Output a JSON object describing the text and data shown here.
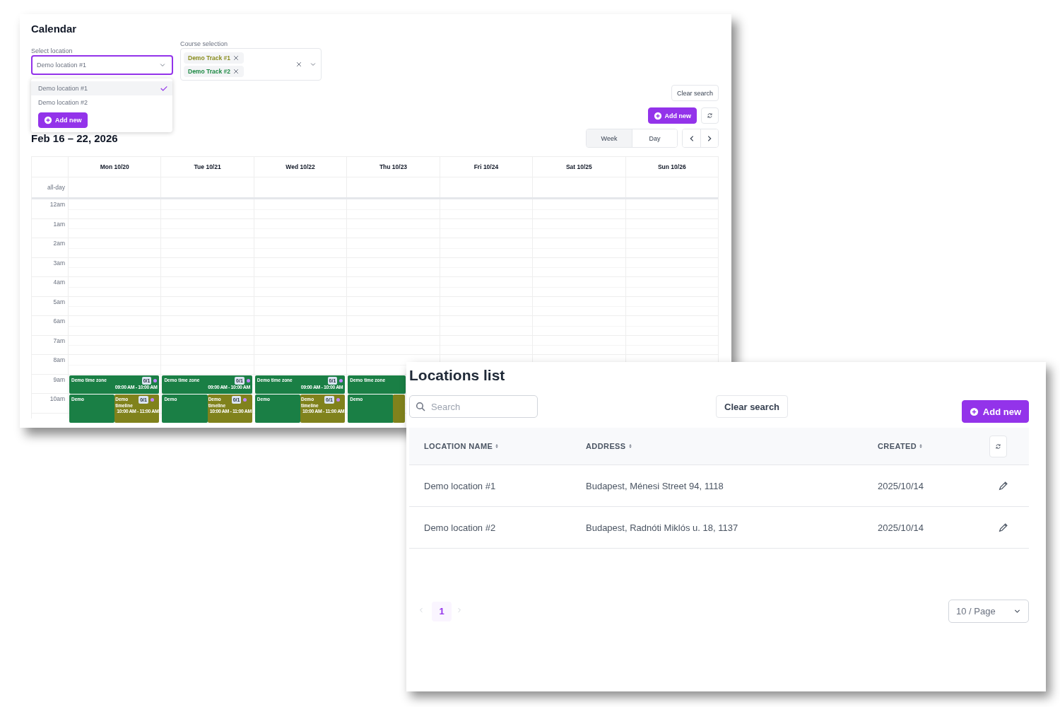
{
  "calendar": {
    "title": "Calendar",
    "location_select": {
      "label": "Select location",
      "value": "Demo location #1",
      "options": [
        {
          "label": "Demo location #1",
          "selected": true
        },
        {
          "label": "Demo location #2",
          "selected": false
        }
      ],
      "add_button": "Add new"
    },
    "course_select": {
      "label": "Course selection",
      "tags": [
        {
          "label": "Demo Track #1",
          "color": "#8a8d1f"
        },
        {
          "label": "Demo Track #2",
          "color": "#1e8a44"
        }
      ]
    },
    "clear_search": "Clear search",
    "add_new": "Add new",
    "date_range": "Feb 16 – 22, 2026",
    "view_tabs": [
      {
        "label": "Week",
        "selected": true
      },
      {
        "label": "Day",
        "selected": false
      }
    ],
    "all_day_label": "all-day",
    "hours": [
      "12am",
      "1am",
      "2am",
      "3am",
      "4am",
      "5am",
      "6am",
      "7am",
      "8am",
      "9am",
      "10am"
    ],
    "days": [
      {
        "label": "Mon 10/20",
        "events": [
          {
            "kind": "zone",
            "title": "Demo time zone",
            "badge": "0/1",
            "time": "09:00 AM - 10:00 AM"
          },
          {
            "kind": "demo",
            "title": "Demo"
          },
          {
            "kind": "timeline",
            "title": "Demo timeline",
            "badge": "0/1",
            "time": "10:00 AM - 11:00 AM"
          }
        ]
      },
      {
        "label": "Tue 10/21",
        "events": [
          {
            "kind": "zone",
            "title": "Demo time zone",
            "badge": "0/1",
            "time": "09:00 AM - 10:00 AM"
          },
          {
            "kind": "demo",
            "title": "Demo"
          },
          {
            "kind": "timeline",
            "title": "Demo timeline",
            "badge": "0/1",
            "time": "10:00 AM - 11:00 AM"
          }
        ]
      },
      {
        "label": "Wed 10/22",
        "events": [
          {
            "kind": "zone",
            "title": "Demo time zone",
            "badge": "0/1",
            "time": "09:00 AM - 10:00 AM"
          },
          {
            "kind": "demo",
            "title": "Demo"
          },
          {
            "kind": "timeline",
            "title": "Demo timeline",
            "badge": "0/1",
            "time": "10:00 AM - 11:00 AM"
          }
        ]
      },
      {
        "label": "Thu 10/23",
        "events": [
          {
            "kind": "zone",
            "title": "Demo time zone"
          },
          {
            "kind": "demo",
            "title": "Demo"
          },
          {
            "kind": "timeline"
          }
        ]
      },
      {
        "label": "Fri 10/24"
      },
      {
        "label": "Sat 10/25"
      },
      {
        "label": "Sun 10/26"
      }
    ]
  },
  "locations": {
    "title": "Locations list",
    "search": {
      "placeholder": "Search"
    },
    "clear_search": "Clear search",
    "add_new": "Add new",
    "columns": [
      "LOCATION NAME",
      "ADDRESS",
      "CREATED"
    ],
    "rows": [
      {
        "name": "Demo location #1",
        "address": "Budapest, Ménesi Street 94, 1118",
        "created": "2025/10/14"
      },
      {
        "name": "Demo location #2",
        "address": "Budapest, Radnóti Miklós u. 18, 1137",
        "created": "2025/10/14"
      }
    ],
    "pagination": {
      "prev_disabled": true,
      "pages": [
        {
          "label": "1",
          "selected": true
        }
      ],
      "next_disabled": true,
      "page_size": "10 / Page"
    }
  }
}
